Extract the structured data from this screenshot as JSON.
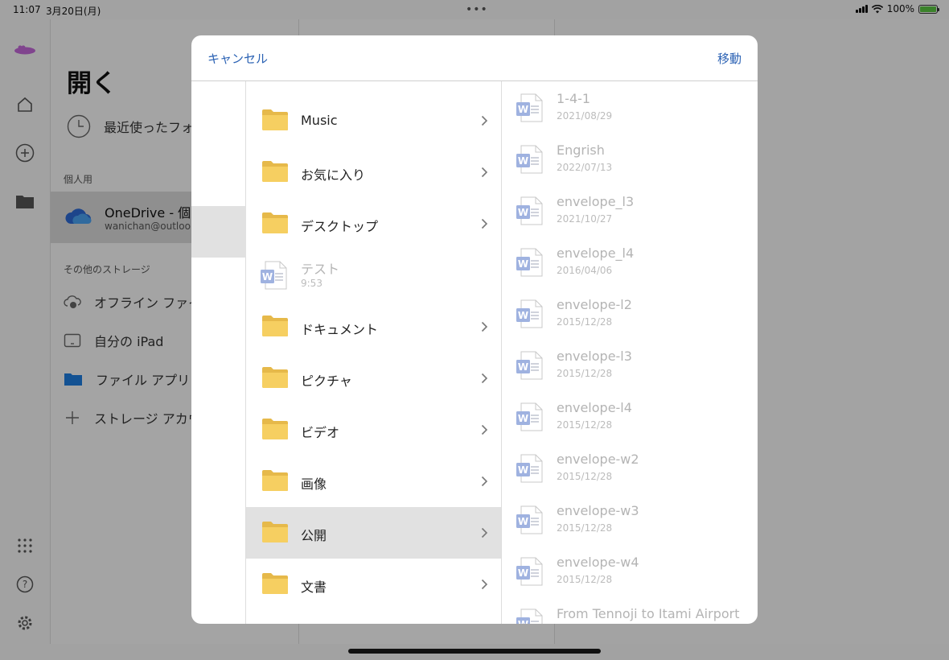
{
  "status_bar": {
    "time": "11:07",
    "date": "3月20日(月)",
    "battery": "100%"
  },
  "nav": {
    "title": "開く",
    "recent_label": "最近使ったフォ",
    "section_personal": "個人用",
    "onedrive_name": "OneDrive - 個人",
    "onedrive_email": "wanichan@outlook",
    "section_other": "その他のストレージ",
    "items": [
      {
        "label": "オフライン ファイ"
      },
      {
        "label": "自分の iPad"
      },
      {
        "label": "ファイル アプリ"
      },
      {
        "label": "ストレージ アカウ"
      }
    ]
  },
  "dialog": {
    "cancel_label": "キャンセル",
    "move_label": "移動",
    "folders": [
      {
        "label": "Music",
        "type": "folder"
      },
      {
        "label": "お気に入り",
        "type": "folder"
      },
      {
        "label": "デスクトップ",
        "type": "folder"
      },
      {
        "label": "テスト",
        "date": "9:53",
        "type": "document"
      },
      {
        "label": "ドキュメント",
        "type": "folder"
      },
      {
        "label": "ピクチャ",
        "type": "folder"
      },
      {
        "label": "ビデオ",
        "type": "folder"
      },
      {
        "label": "画像",
        "type": "folder"
      },
      {
        "label": "公開",
        "type": "folder",
        "selected": true
      },
      {
        "label": "文書",
        "type": "folder"
      }
    ],
    "files": [
      {
        "name": "1-4-1",
        "date": "2021/08/29"
      },
      {
        "name": "Engrish",
        "date": "2022/07/13"
      },
      {
        "name": "envelope_l3",
        "date": "2021/10/27"
      },
      {
        "name": "envelope_l4",
        "date": "2016/04/06"
      },
      {
        "name": "envelope-l2",
        "date": "2015/12/28"
      },
      {
        "name": "envelope-l3",
        "date": "2015/12/28"
      },
      {
        "name": "envelope-l4",
        "date": "2015/12/28"
      },
      {
        "name": "envelope-w2",
        "date": "2015/12/28"
      },
      {
        "name": "envelope-w3",
        "date": "2015/12/28"
      },
      {
        "name": "envelope-w4",
        "date": "2015/12/28"
      },
      {
        "name": "From Tennoji to Itami Airport",
        "date": ""
      }
    ]
  },
  "colors": {
    "accent": "#2b62b4",
    "folder": "#f6cf61",
    "word": "#9fb2e0"
  }
}
